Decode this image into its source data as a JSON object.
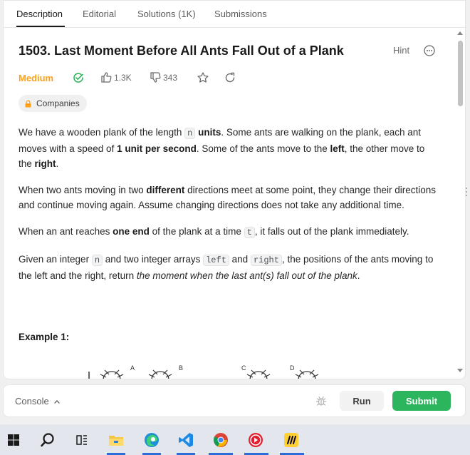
{
  "tabs": [
    {
      "label": "Description"
    },
    {
      "label": "Editorial"
    },
    {
      "label": "Solutions (1K)"
    },
    {
      "label": "Submissions"
    }
  ],
  "problem": {
    "title": "1503. Last Moment Before All Ants Fall Out of a Plank",
    "hint_label": "Hint",
    "difficulty": "Medium",
    "likes": "1.3K",
    "dislikes": "343",
    "companies_label": "Companies"
  },
  "description": {
    "p1": {
      "t1": "We have a wooden plank of the length ",
      "code1": "n",
      "b1": " units",
      "t2": ". Some ants are walking on the plank, each ant moves with a speed of ",
      "b2": "1 unit per second",
      "t3": ". Some of the ants move to the ",
      "b3": "left",
      "t4": ", the other move to the ",
      "b4": "right",
      "t5": "."
    },
    "p2": {
      "t1": "When two ants moving in two ",
      "b1": "different",
      "t2": " directions meet at some point, they change their directions and continue moving again. Assume changing directions does not take any additional time."
    },
    "p3": {
      "t1": "When an ant reaches ",
      "b1": "one end",
      "t2": " of the plank at a time ",
      "code1": "t",
      "t3": ", it falls out of the plank immediately."
    },
    "p4": {
      "t1": "Given an integer ",
      "code1": "n",
      "t2": " and two integer arrays ",
      "code2": "left",
      "t3": " and ",
      "code3": "right",
      "t4": ", the positions of the ants moving to the left and the right, return ",
      "i1": "the moment when the last ant(s) fall out of the plank",
      "t5": "."
    },
    "example_title": "Example 1:",
    "ant_labels": [
      "A",
      "B",
      "C",
      "D"
    ]
  },
  "bottom": {
    "console_label": "Console",
    "run_label": "Run",
    "submit_label": "Submit"
  },
  "colors": {
    "difficulty": "#ffa116",
    "submit": "#2db55d",
    "accent_taskbar": "#2c6bd6"
  },
  "taskbar_icons": [
    "windows-start-icon",
    "search-icon",
    "task-view-icon",
    "file-explorer-icon",
    "edge-icon",
    "vscode-icon",
    "chrome-icon",
    "media-player-icon",
    "miro-icon"
  ]
}
